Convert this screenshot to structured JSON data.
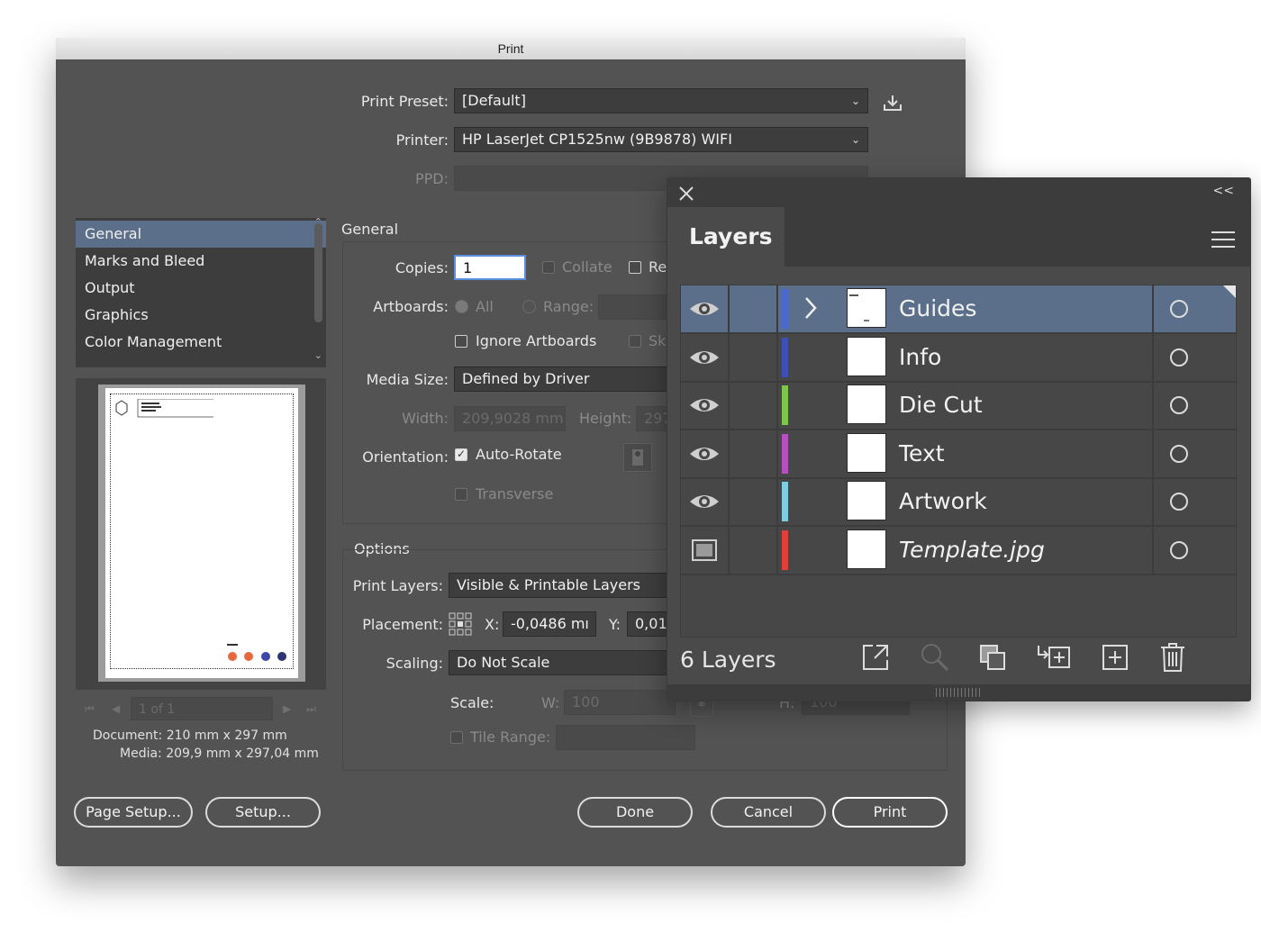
{
  "dialog": {
    "title": "Print",
    "print_preset": {
      "label": "Print Preset:",
      "value": "[Default]"
    },
    "printer": {
      "label": "Printer:",
      "value": "HP LaserJet CP1525nw (9B9878) WIFI"
    },
    "ppd": {
      "label": "PPD:"
    },
    "categories": [
      "General",
      "Marks and Bleed",
      "Output",
      "Graphics",
      "Color Management"
    ],
    "selected_category": "General",
    "general_heading": "General",
    "copies": {
      "label": "Copies:",
      "value": "1"
    },
    "collate": "Collate",
    "reverse": "Re",
    "artboards": {
      "label": "Artboards:",
      "all": "All",
      "range": "Range:"
    },
    "ignore_artboards": "Ignore Artboards",
    "skip": "Sk",
    "media_size": {
      "label": "Media Size:",
      "value": "Defined by Driver"
    },
    "width": {
      "label": "Width:",
      "value": "209,9028 mm"
    },
    "height": {
      "label": "Height:",
      "value": "297"
    },
    "orientation": {
      "label": "Orientation:",
      "auto_rotate": "Auto-Rotate"
    },
    "transverse": "Transverse",
    "options_heading": "Options",
    "print_layers": {
      "label": "Print Layers:",
      "value": "Visible & Printable Layers"
    },
    "placement": {
      "label": "Placement:",
      "x_label": "X:",
      "x_value": "-0,0486 mı",
      "y_label": "Y:",
      "y_value": "0,01"
    },
    "scaling": {
      "label": "Scaling:",
      "value": "Do Not Scale"
    },
    "scale": {
      "label": "Scale:",
      "w_label": "W:",
      "w_value": "100",
      "h_label": "H:",
      "h_value": "100"
    },
    "tile_range": "Tile Range:",
    "page_nav": "1 of 1",
    "document_info": "Document: 210 mm x 297 mm",
    "media_info": "Media: 209,9 mm x 297,04 mm",
    "buttons": {
      "page_setup": "Page Setup...",
      "setup": "Setup...",
      "done": "Done",
      "cancel": "Cancel",
      "print": "Print"
    }
  },
  "layers_panel": {
    "title": "Layers",
    "collapse_label": "<<",
    "layers": [
      {
        "name": "Guides",
        "color": "#4a68d0",
        "selected": true,
        "expandable": true,
        "visibility": "eye-icon"
      },
      {
        "name": "Info",
        "color": "#3f4fb8",
        "selected": false,
        "expandable": false,
        "visibility": "eye-icon"
      },
      {
        "name": "Die Cut",
        "color": "#7ec64a",
        "selected": false,
        "expandable": false,
        "visibility": "eye-icon"
      },
      {
        "name": "Text",
        "color": "#b64fbf",
        "selected": false,
        "expandable": false,
        "visibility": "eye-icon"
      },
      {
        "name": "Artwork",
        "color": "#7fcde0",
        "selected": false,
        "expandable": false,
        "visibility": "eye-icon"
      },
      {
        "name": "Template.jpg",
        "color": "#e0403a",
        "selected": false,
        "expandable": false,
        "visibility": "template-icon",
        "italic": true
      }
    ],
    "count_label": "6 Layers"
  }
}
